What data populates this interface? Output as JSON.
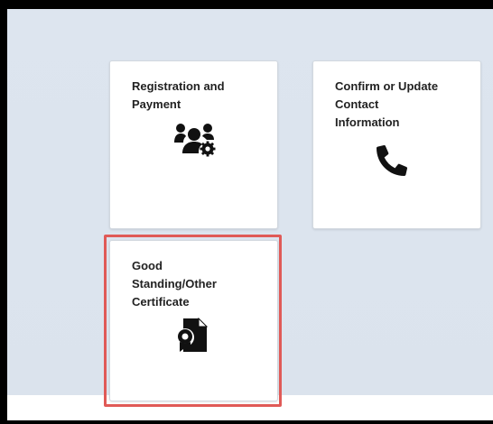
{
  "tiles": [
    {
      "label": "Registration and\nPayment",
      "icon": "users-gear-icon"
    },
    {
      "label": "Confirm or Update\nContact\nInformation",
      "icon": "phone-icon"
    },
    {
      "label": "Good\nStanding/Other\nCertificate",
      "icon": "certificate-document-icon"
    }
  ],
  "highlight": {
    "color": "#e05a57",
    "target": "Good Standing/Other Certificate"
  },
  "colors": {
    "background": "#dde5ef",
    "tile": "#ffffff",
    "icon": "#111111",
    "frame": "#000000"
  }
}
